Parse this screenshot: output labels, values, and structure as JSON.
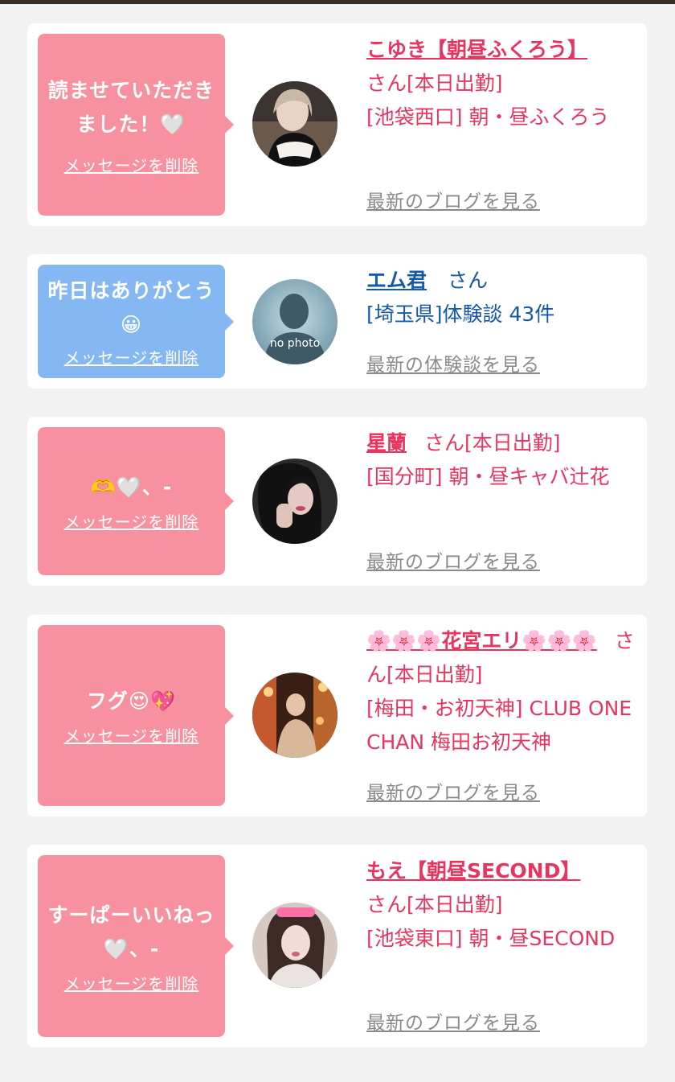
{
  "messages": [
    {
      "message": "読ませていただきました！🤍",
      "delete_label": "メッセージを削除",
      "name": "こゆき【朝昼ふくろう】",
      "name_suffix": "さん[本日出勤]",
      "details": "[池袋西口] 朝・昼ふくろう",
      "more_label": "最新のブログを見る"
    },
    {
      "message": "昨日はありがとう😀",
      "delete_label": "メッセージを削除",
      "name": "エム君",
      "name_suffix": "さん",
      "details": "[埼玉県]体験談 43件",
      "avatar_text": "no photo",
      "more_label": "最新の体験談を見る"
    },
    {
      "message": "🫶🤍、-",
      "delete_label": "メッセージを削除",
      "name": "星蘭",
      "name_suffix": "さん[本日出勤]",
      "details": "[国分町] 朝・昼キャバ辻花",
      "more_label": "最新のブログを見る"
    },
    {
      "message": "フグ😍💖",
      "delete_label": "メッセージを削除",
      "name": "🌸🌸🌸花宮エリ🌸🌸🌸",
      "name_suffix": "さん[本日出勤]",
      "details": "[梅田・お初天神] CLUB ONE CHAN 梅田お初天神",
      "more_label": "最新のブログを見る"
    },
    {
      "message": "すーぱーいいねっ🤍、-",
      "delete_label": "メッセージを削除",
      "name": "もえ【朝昼SECOND】",
      "name_suffix": "さん[本日出勤]",
      "details": "[池袋東口] 朝・昼SECOND",
      "more_label": "最新のブログを見る"
    }
  ],
  "colors": {
    "pink_bubble": "#f8919f",
    "blue_bubble": "#85b7f2",
    "pink_text": "#e8355f",
    "blue_text": "#145aa8",
    "link_gray": "#8a8a8a"
  }
}
